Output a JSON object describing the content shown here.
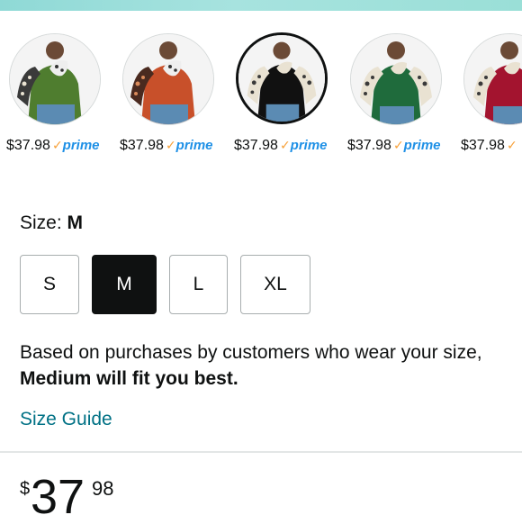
{
  "swatches": [
    {
      "name": "green",
      "price": "$37.98",
      "prime": "prime",
      "sweater_color": "#4f7d2f",
      "sleeve": "leopard-dark",
      "selected": false
    },
    {
      "name": "orange",
      "price": "$37.98",
      "prime": "prime",
      "sweater_color": "#c8502a",
      "sleeve": "leopard-dark",
      "selected": false
    },
    {
      "name": "black",
      "price": "$37.98",
      "prime": "prime",
      "sweater_color": "#111111",
      "sleeve": "leopard-light",
      "selected": true
    },
    {
      "name": "dark-green",
      "price": "$37.98",
      "prime": "prime",
      "sweater_color": "#1f6b3c",
      "sleeve": "leopard-light",
      "selected": false
    },
    {
      "name": "burgundy",
      "price": "$37.98",
      "prime": "prime",
      "sweater_color": "#a3142f",
      "sleeve": "leopard-light",
      "selected": false
    }
  ],
  "size": {
    "label": "Size:",
    "selected": "M",
    "options": [
      "S",
      "M",
      "L",
      "XL"
    ]
  },
  "fit": {
    "text": "Based on purchases by customers who wear your size, ",
    "bold": "Medium will fit you best."
  },
  "size_guide": "Size Guide",
  "price": {
    "symbol": "$",
    "whole": "37",
    "fraction": "98"
  },
  "colors": {
    "accent_link": "#007185",
    "prime_blue": "#1e90e6",
    "prime_check": "#f7a13a",
    "selected_bg": "#0f1111"
  }
}
